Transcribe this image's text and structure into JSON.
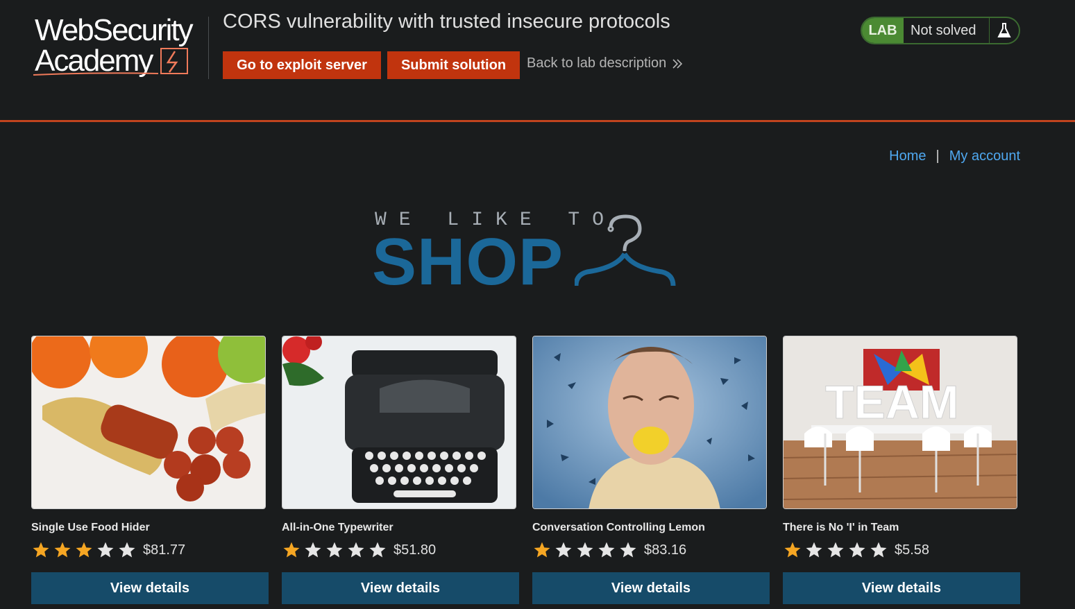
{
  "header": {
    "logo_line1": "WebSecurity",
    "logo_line2": "Academy",
    "lab_title": "CORS vulnerability with trusted insecure protocols",
    "exploit_button": "Go to exploit server",
    "submit_button": "Submit solution",
    "back_link": "Back to lab description",
    "lab_tag": "LAB",
    "lab_status": "Not solved"
  },
  "nav": {
    "home": "Home",
    "separator": "|",
    "my_account": "My account"
  },
  "banner": {
    "tagline": "WE LIKE TO",
    "shop": "SHOP"
  },
  "products": [
    {
      "name": "Single Use Food Hider",
      "rating": 3,
      "price": "$81.77",
      "button": "View details"
    },
    {
      "name": "All-in-One Typewriter",
      "rating": 1,
      "price": "$51.80",
      "button": "View details"
    },
    {
      "name": "Conversation Controlling Lemon",
      "rating": 1,
      "price": "$83.16",
      "button": "View details"
    },
    {
      "name": "There is No 'I' in Team",
      "rating": 1,
      "price": "$5.58",
      "button": "View details"
    }
  ],
  "colors": {
    "accent_orange": "#c1340e",
    "lab_green": "#4b8a33",
    "link_blue": "#4fa8f0",
    "button_blue": "#164b69",
    "star_filled": "#f5a623",
    "star_empty": "#e6e6e6"
  }
}
